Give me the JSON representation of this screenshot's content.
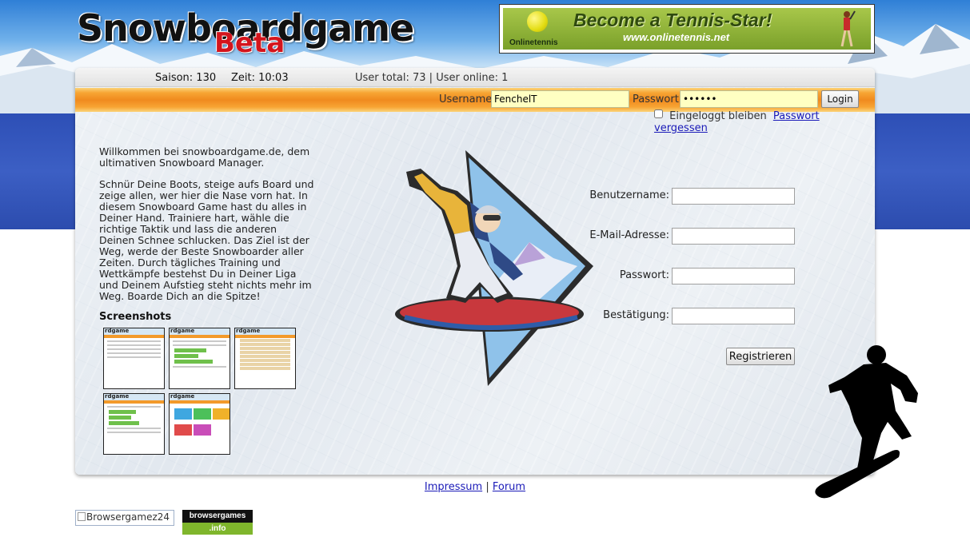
{
  "header": {
    "logo_text": "Snowboardgame",
    "logo_badge": "Beta"
  },
  "ad": {
    "brand": "Onlinetennis",
    "title": "Become a Tennis-Star!",
    "url": "www.onlinetennis.net"
  },
  "status": {
    "saison": "Saison: 130",
    "zeit": "Zeit: 10:03",
    "users": "User total: 73 | User online: 1"
  },
  "login": {
    "username_label": "Username",
    "username_value": "FenchelT",
    "password_label": "Passwort",
    "password_value": "••••••",
    "login_button": "Login",
    "remember_label": "Eingeloggt bleiben",
    "forgot_link": "Passwort vergessen"
  },
  "intro": {
    "welcome": "Willkommen bei snowboardgame.de, dem ultimativen Snowboard Manager.",
    "body": "Schnür Deine Boots, steige aufs Board und zeige allen, wer hier die Nase vorn hat. In diesem Snowboard Game hast du alles in Deiner Hand. Trainiere hart, wähle die richtige Taktik und lass die anderen Deinen Schnee schlucken. Das Ziel ist der Weg, werde der Beste Snowboarder aller Zeiten. Durch tägliches Training und Wettkämpfe bestehst Du in Deiner Liga und Deinem Aufstieg steht nichts mehr im Weg. Boarde Dich an die Spitze!",
    "screenshots_title": "Screenshots",
    "thumb_logo": "rdgame"
  },
  "register": {
    "username_label": "Benutzername:",
    "email_label": "E-Mail-Adresse:",
    "password_label": "Passwort:",
    "confirm_label": "Bestätigung:",
    "submit": "Registrieren"
  },
  "footer": {
    "impressum": "Impressum",
    "separator": "|",
    "forum": "Forum",
    "badge1_alt": "Browsergamez24",
    "badge2_top": "browsergames",
    "badge2_bottom": ".info"
  },
  "colors": {
    "accent_orange": "#f08a1e",
    "input_yellow": "#ffffc2",
    "link_blue": "#1a1ab8",
    "sky_band": "#2d4fb6"
  }
}
